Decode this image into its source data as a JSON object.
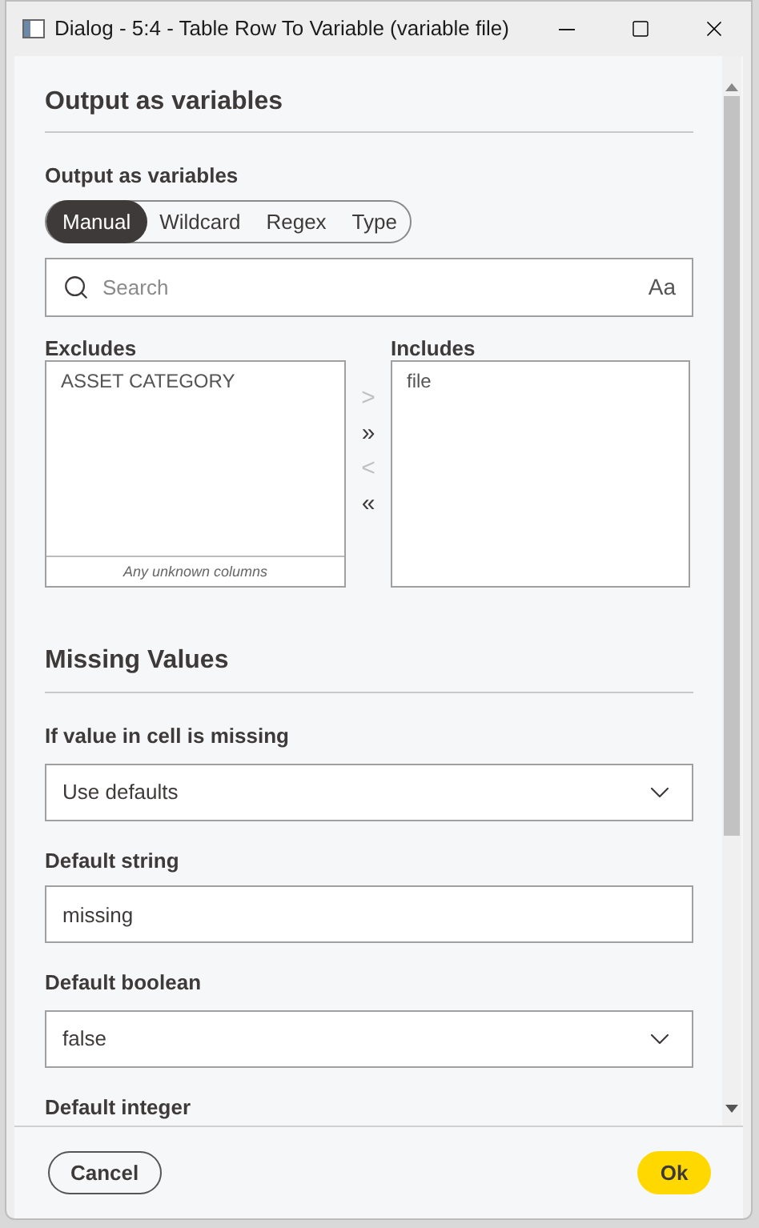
{
  "window": {
    "title": "Dialog - 5:4 - Table Row To Variable (variable file)"
  },
  "output_section": {
    "heading": "Output as variables",
    "label": "Output as variables",
    "modes": [
      {
        "label": "Manual",
        "selected": true
      },
      {
        "label": "Wildcard",
        "selected": false
      },
      {
        "label": "Regex",
        "selected": false
      },
      {
        "label": "Type",
        "selected": false
      }
    ],
    "search": {
      "placeholder": "Search",
      "case_toggle": "Aa"
    },
    "excludes": {
      "label": "Excludes",
      "items": [
        "ASSET CATEGORY"
      ],
      "footer": "Any unknown columns"
    },
    "transfer_buttons": [
      {
        "label": ">",
        "disabled": true
      },
      {
        "label": "»",
        "disabled": false
      },
      {
        "label": "<",
        "disabled": true
      },
      {
        "label": "«",
        "disabled": false
      }
    ],
    "includes": {
      "label": "Includes",
      "items": [
        "file"
      ]
    }
  },
  "missing_section": {
    "heading": "Missing Values",
    "fields": [
      {
        "kind": "dropdown",
        "label": "If value in cell is missing",
        "value": "Use defaults"
      },
      {
        "kind": "text",
        "label": "Default string",
        "value": "missing"
      },
      {
        "kind": "dropdown",
        "label": "Default boolean",
        "value": "false"
      },
      {
        "kind": "label",
        "label": "Default integer"
      }
    ]
  },
  "buttons": {
    "cancel": "Cancel",
    "ok": "Ok"
  }
}
